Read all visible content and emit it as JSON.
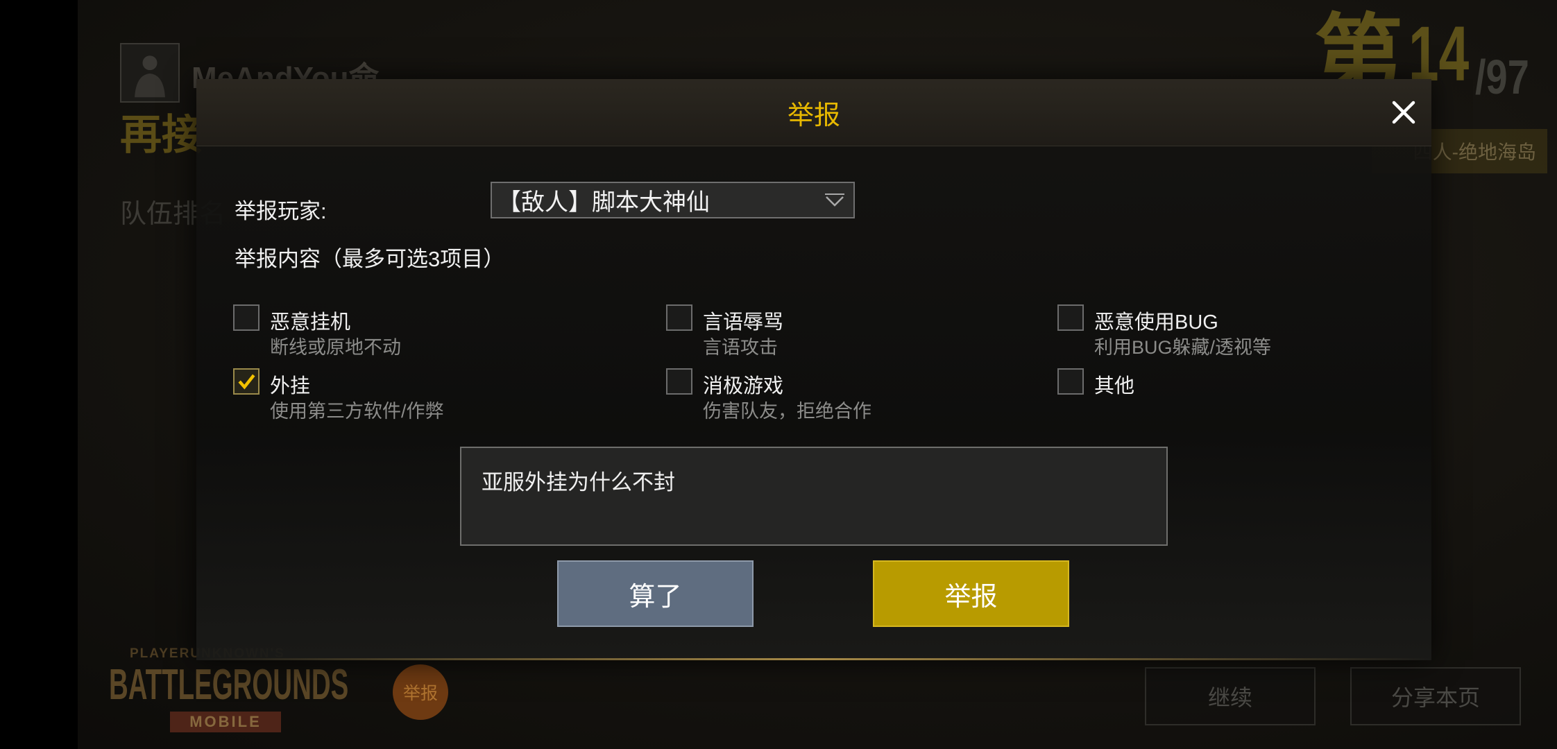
{
  "background": {
    "player_name": "MeAndYou命",
    "slogan": "再接",
    "team_rank_label": "队伍排名",
    "rank_prefix": "第",
    "rank": "14",
    "rank_total": "/97",
    "mode": "四人-绝地海岛",
    "logo": {
      "top": "PLAYERUNKNOWN'S",
      "main": "BATTLEGROUNDS",
      "sub": "MOBILE"
    },
    "report_circle_label": "举报",
    "continue_label": "继续",
    "share_label": "分享本页"
  },
  "dialog": {
    "title": "举报",
    "close_icon": "close-icon",
    "player_label": "举报玩家:",
    "player_selected": "【敌人】脚本大神仙",
    "dropdown_icon": "chevron-down-icon",
    "content_label": "举报内容（最多可选3项目）",
    "options": [
      {
        "label": "恶意挂机",
        "description": "断线或原地不动",
        "checked": false
      },
      {
        "label": "言语辱骂",
        "description": "言语攻击",
        "checked": false
      },
      {
        "label": "恶意使用BUG",
        "description": "利用BUG躲藏/透视等",
        "checked": false
      },
      {
        "label": "外挂",
        "description": "使用第三方软件/作弊",
        "checked": true
      },
      {
        "label": "消极游戏",
        "description": "伤害队友，拒绝合作",
        "checked": false
      },
      {
        "label": "其他",
        "checked": false
      }
    ],
    "comment": "亚服外挂为什么不封",
    "cancel_label": "算了",
    "submit_label": "举报"
  },
  "colors": {
    "accent": "#e8b900",
    "submit_bg": "#b89b00",
    "cancel_bg": "#5f6d80",
    "checkmark": "#f2c200"
  }
}
